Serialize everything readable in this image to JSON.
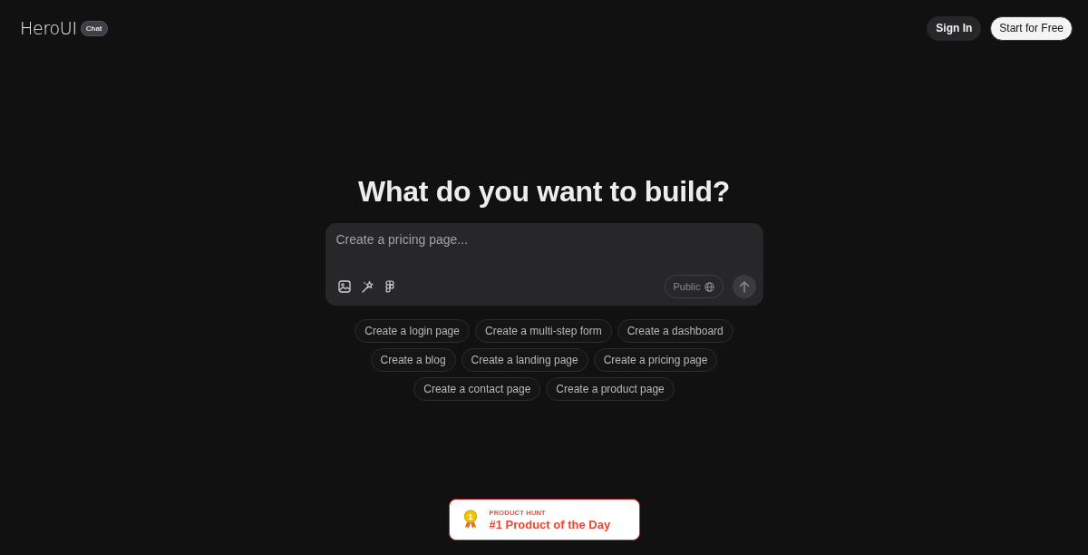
{
  "header": {
    "logo": "HeroUI",
    "logo_badge": "Chat",
    "buttons": [
      {
        "label": "Sign In",
        "kind": "secondary"
      },
      {
        "label": "Start for Free",
        "kind": "primary"
      }
    ]
  },
  "hero": {
    "title": "What do you want to build?"
  },
  "prompt": {
    "placeholder": "Create a pricing page...",
    "visibility": "Public",
    "send_disabled": true
  },
  "suggestions": [
    "Create a login page",
    "Create a multi-step form",
    "Create a dashboard",
    "Create a blog",
    "Create a landing page",
    "Create a pricing page",
    "Create a contact page",
    "Create a product page"
  ],
  "badge": {
    "medal": "1",
    "eyebrow": "PRODUCT HUNT",
    "title": "#1 Product of the Day"
  }
}
